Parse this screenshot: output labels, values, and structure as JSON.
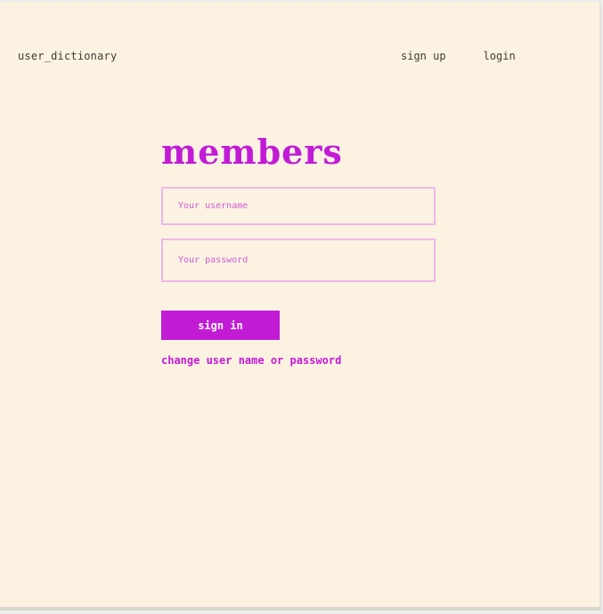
{
  "header": {
    "brand": "user_dictionary",
    "nav": {
      "signup_label": "sign up",
      "login_label": "login"
    }
  },
  "login_form": {
    "title": "members",
    "username_placeholder": "Your username",
    "password_placeholder": "Your password",
    "signin_label": "sign in",
    "change_link_label": "change user name or password"
  },
  "colors": {
    "background": "#fbf2e1",
    "accent": "#c21bd6",
    "input_border": "#efb6eb",
    "nav_text": "#3f3a36"
  }
}
